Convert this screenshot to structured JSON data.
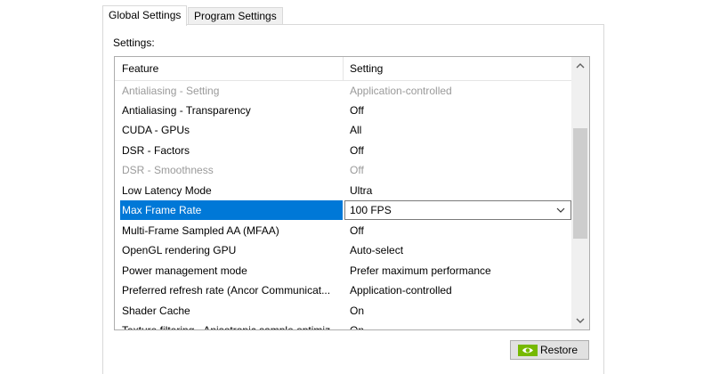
{
  "tabs": [
    {
      "label": "Global Settings",
      "active": true
    },
    {
      "label": "Program Settings",
      "active": false
    }
  ],
  "settings_label": "Settings:",
  "grid": {
    "columns": [
      "Feature",
      "Setting"
    ],
    "rows": [
      {
        "feature": "Antialiasing - Setting",
        "setting": "Application-controlled",
        "disabled": true
      },
      {
        "feature": "Antialiasing - Transparency",
        "setting": "Off"
      },
      {
        "feature": "CUDA - GPUs",
        "setting": "All"
      },
      {
        "feature": "DSR - Factors",
        "setting": "Off"
      },
      {
        "feature": "DSR - Smoothness",
        "setting": "Off",
        "disabled": true
      },
      {
        "feature": "Low Latency Mode",
        "setting": "Ultra"
      },
      {
        "feature": "Max Frame Rate",
        "setting": "100 FPS",
        "selected": true
      },
      {
        "feature": "Multi-Frame Sampled AA (MFAA)",
        "setting": "Off"
      },
      {
        "feature": "OpenGL rendering GPU",
        "setting": "Auto-select"
      },
      {
        "feature": "Power management mode",
        "setting": "Prefer maximum performance"
      },
      {
        "feature": "Preferred refresh rate (Ancor Communicat...",
        "setting": "Application-controlled"
      },
      {
        "feature": "Shader Cache",
        "setting": "On"
      },
      {
        "feature": "Texture filtering - Anisotropic sample optimiz...",
        "setting": "On"
      }
    ]
  },
  "restore_button": {
    "label": "Restore",
    "icon": "nvidia-logo-icon"
  },
  "colors": {
    "selection": "#0078d7",
    "disabled_text": "#9a9a9a",
    "nvidia_green": "#76b900"
  }
}
